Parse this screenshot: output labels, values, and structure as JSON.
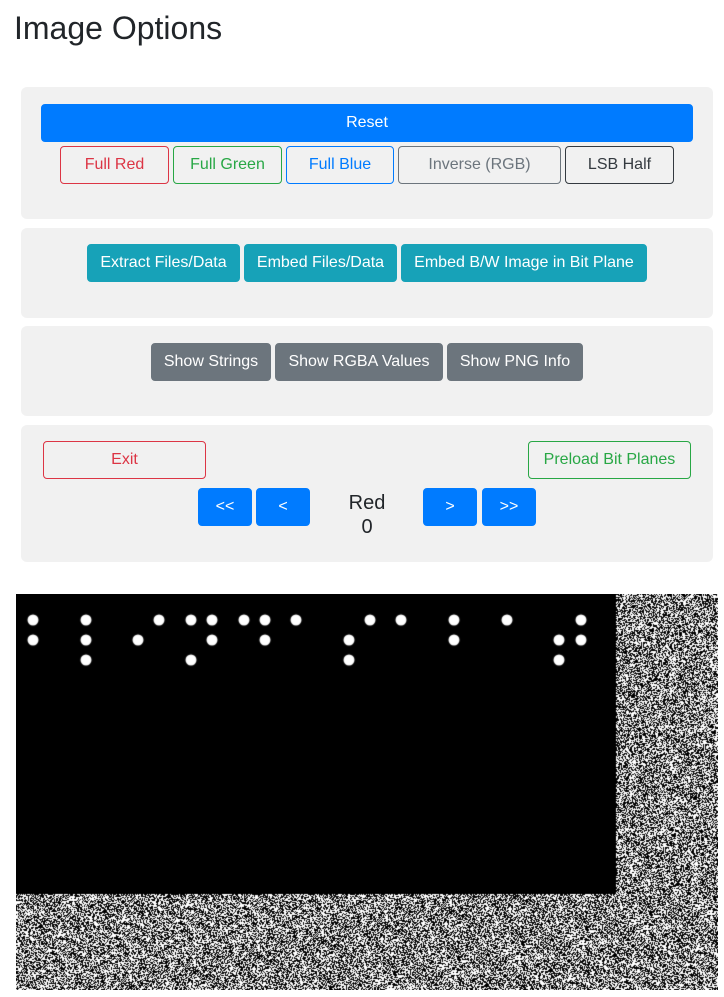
{
  "page": {
    "title": "Image Options"
  },
  "color_panel": {
    "reset_label": "Reset",
    "full_red_label": "Full Red",
    "full_green_label": "Full Green",
    "full_blue_label": "Full Blue",
    "inverse_label": "Inverse (RGB)",
    "lsb_half_label": "LSB Half"
  },
  "data_panel": {
    "extract_label": "Extract Files/Data",
    "embed_label": "Embed Files/Data",
    "embed_bw_label": "Embed B/W Image in Bit Plane"
  },
  "info_panel": {
    "strings_label": "Show Strings",
    "rgba_label": "Show RGBA Values",
    "png_info_label": "Show PNG Info"
  },
  "nav_panel": {
    "exit_label": "Exit",
    "preload_label": "Preload Bit Planes",
    "first_label": "<<",
    "prev_label": "<",
    "current_plane": "Red 0",
    "next_label": ">",
    "last_label": ">>"
  },
  "colors": {
    "primary": "#007bff",
    "info": "#17a2b8",
    "secondary": "#6c757d",
    "danger": "#dc3545",
    "success": "#28a745",
    "panel_bg": "#f1f1f1"
  }
}
